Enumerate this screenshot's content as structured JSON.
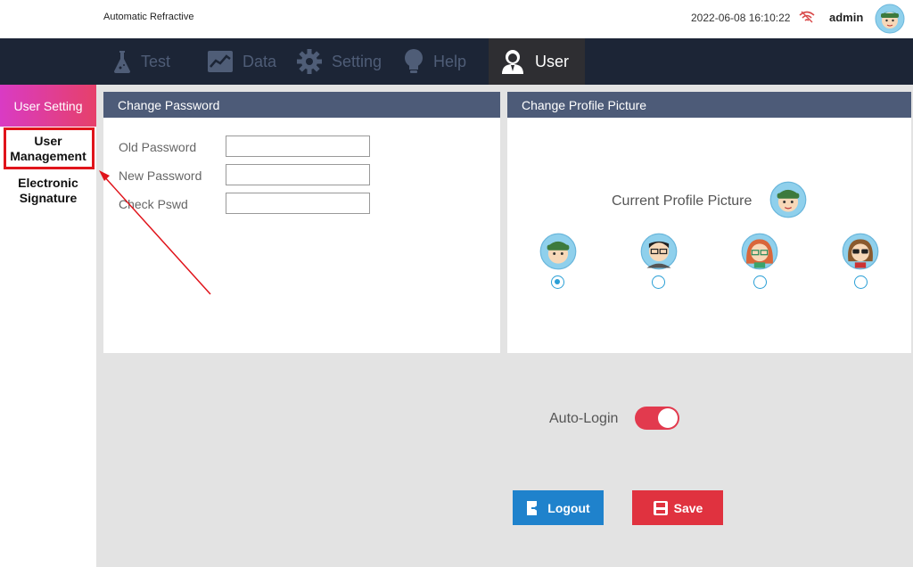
{
  "header": {
    "app_title": "Automatic Refractive",
    "datetime": "2022-06-08 16:10:22",
    "username": "admin"
  },
  "nav": {
    "items": [
      {
        "label": "Test",
        "icon": "flask-icon"
      },
      {
        "label": "Data",
        "icon": "chart-icon"
      },
      {
        "label": "Setting",
        "icon": "gear-icon"
      },
      {
        "label": "Help",
        "icon": "bulb-icon"
      },
      {
        "label": "User",
        "icon": "user-icon"
      }
    ],
    "active": "User"
  },
  "sidebar": {
    "header": "User Setting",
    "items": [
      {
        "label": "User Management"
      },
      {
        "label": "Electronic Signature"
      }
    ]
  },
  "change_password": {
    "title": "Change Password",
    "fields": [
      {
        "label": "Old Password",
        "value": ""
      },
      {
        "label": "New Password",
        "value": ""
      },
      {
        "label": "Check Pswd",
        "value": ""
      }
    ]
  },
  "profile_picture": {
    "title": "Change Profile Picture",
    "current_label": "Current Profile Picture",
    "selected_index": 0
  },
  "auto_login": {
    "label": "Auto-Login",
    "enabled": true
  },
  "buttons": {
    "logout": "Logout",
    "save": "Save"
  },
  "colors": {
    "nav_bg": "#1c2536",
    "panel_header": "#4d5b78",
    "accent_red": "#e0323f",
    "accent_blue": "#1f82cc",
    "radio_blue": "#2a9fd6"
  }
}
